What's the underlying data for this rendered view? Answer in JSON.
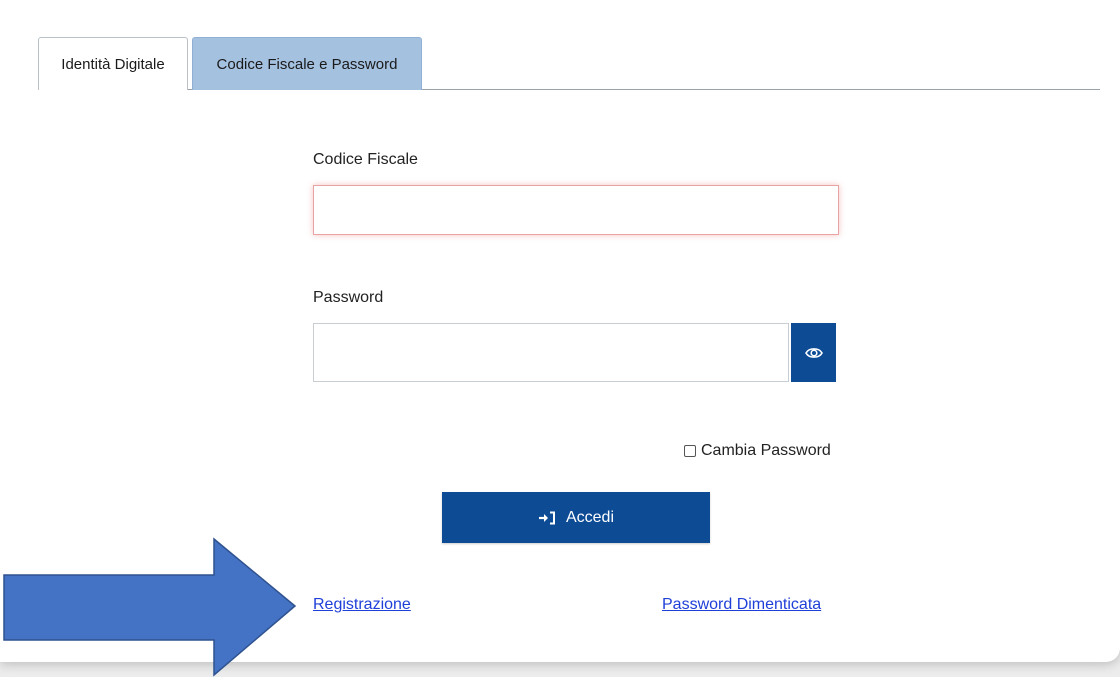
{
  "tabs": [
    {
      "label": "Identità Digitale",
      "active": false
    },
    {
      "label": "Codice Fiscale e Password",
      "active": true
    }
  ],
  "form": {
    "codice_fiscale_label": "Codice Fiscale",
    "codice_fiscale_value": "",
    "password_label": "Password",
    "password_value": "",
    "show_password_icon": "eye-icon",
    "cambia_password_label": "Cambia Password",
    "cambia_password_checked": false,
    "submit_label": "Accedi",
    "submit_icon": "sign-in-icon"
  },
  "links": {
    "registrazione": "Registrazione",
    "password_dimenticata": "Password Dimenticata"
  },
  "colors": {
    "primary": "#0d4b95",
    "active_tab": "#a5c1e0",
    "link": "#1f3fd9",
    "annotation_arrow": "#4472c4",
    "input_error_border": "#e9a3a3"
  }
}
